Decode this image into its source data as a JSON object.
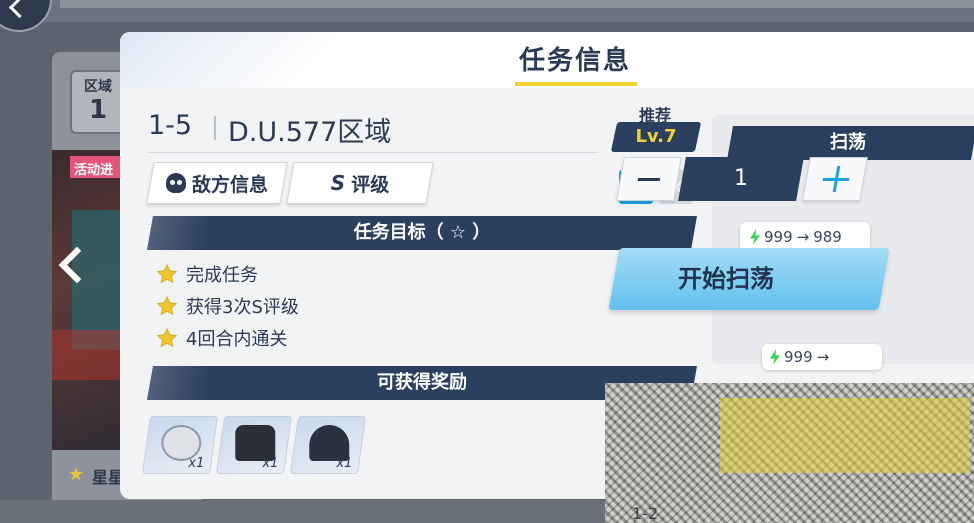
{
  "background": {
    "area_label": "区域",
    "area_number": "1",
    "event_tag": "活动进",
    "bottom_label": "星星",
    "bottom_number": "1-2"
  },
  "modal": {
    "title": "任务信息",
    "stage_id": "1-5",
    "stage_name": "D.U.577区域",
    "recommended_label": "推荐",
    "recommended_level": "Lv.7",
    "tabs": [
      {
        "label": "敌方信息",
        "icon": "skull-icon"
      },
      {
        "label": "评级",
        "icon": "s-rank-icon",
        "prefix": "S"
      }
    ],
    "objectives_header": "任务目标（ ☆ ）",
    "objectives": [
      "完成任务",
      "获得3次S评级",
      "4回合内通关"
    ],
    "rewards_header": "可获得奖励",
    "rewards": [
      {
        "name": "badge",
        "qty": "x1"
      },
      {
        "name": "bag",
        "qty": "x1"
      },
      {
        "name": "cap",
        "qty": "x1"
      }
    ]
  },
  "sweep": {
    "header": "扫荡",
    "quantity": "1",
    "ap_cost_1": "999",
    "ap_result_1": "989",
    "start_label": "开始扫荡",
    "ap_cost_2": "999"
  },
  "colors": {
    "navy": "#2b3f5e",
    "accent_yellow": "#f2d22e",
    "accent_blue": "#1aa2e6",
    "star": "#f2c52e"
  }
}
